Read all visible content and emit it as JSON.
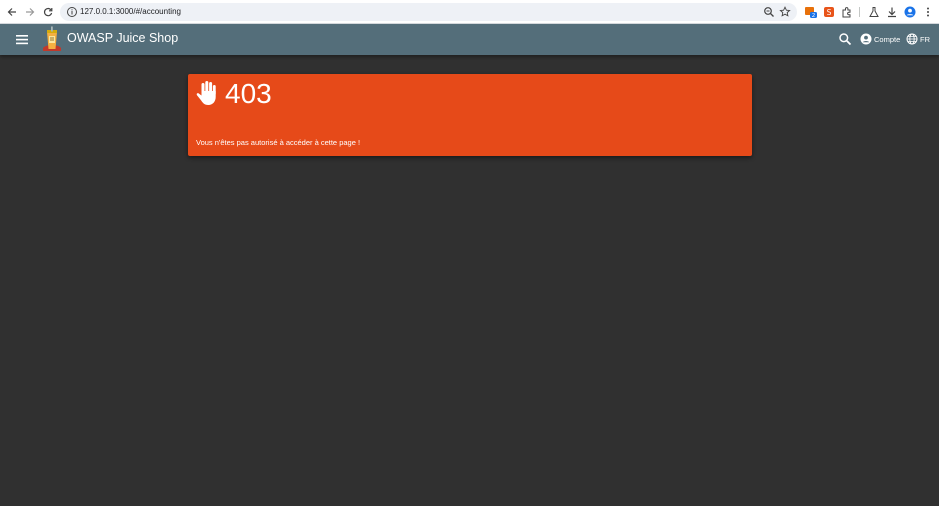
{
  "browser": {
    "url": "127.0.0.1:3000/#/accounting",
    "extension_badge": "2",
    "extension_letter": "S"
  },
  "toolbar": {
    "app_title": "OWASP Juice Shop",
    "account_label": "Compte",
    "language_label": "FR",
    "background_color": "#546e7a"
  },
  "error": {
    "code": "403",
    "message": "Vous n'êtes pas autorisé à accéder à cette page !",
    "background_color": "#e64a19"
  },
  "icons": {
    "menu": "menu-icon",
    "search": "search-icon",
    "account": "account-circle-icon",
    "language": "globe-icon",
    "error": "hand-stop-icon"
  }
}
